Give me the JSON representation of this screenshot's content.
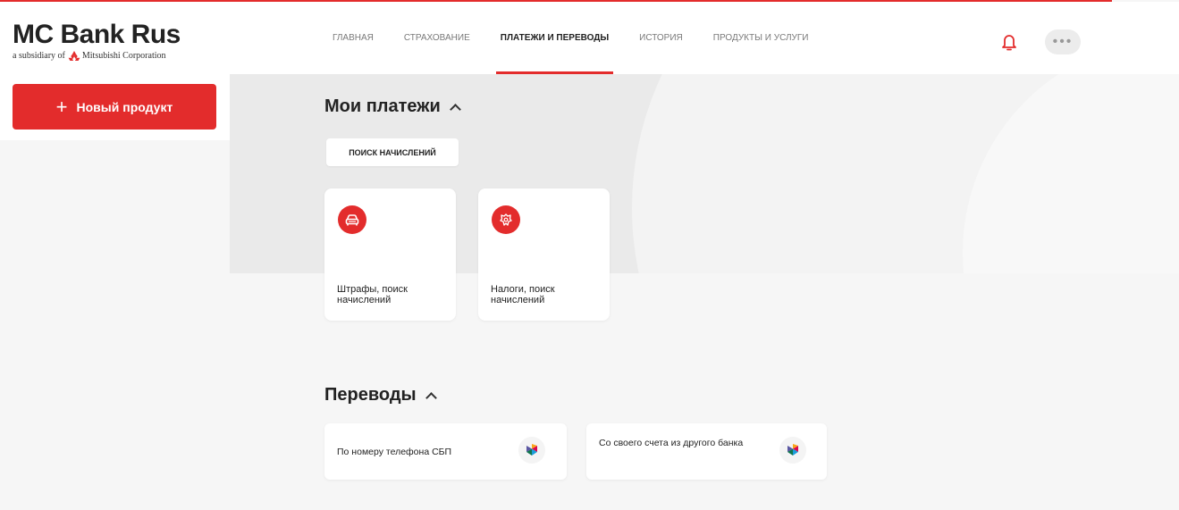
{
  "brand": {
    "name": "MC Bank Rus",
    "subtitle_prefix": "a subsidiary of",
    "subtitle_company": "Mitsubishi Corporation",
    "accent_color": "#e32c2c"
  },
  "nav": {
    "items": [
      {
        "label": "ГЛАВНАЯ",
        "active": false
      },
      {
        "label": "СТРАХОВАНИЕ",
        "active": false
      },
      {
        "label": "ПЛАТЕЖИ И ПЕРЕВОДЫ",
        "active": true
      },
      {
        "label": "ИСТОРИЯ",
        "active": false
      },
      {
        "label": "ПРОДУКТЫ И УСЛУГИ",
        "active": false
      }
    ],
    "bell_icon": "bell-icon",
    "more_icon": "more-dots-icon",
    "more_label": "•••"
  },
  "sidebar": {
    "new_product_label": "Новый продукт",
    "plus_icon": "plus-icon",
    "plus_glyph": "+"
  },
  "payments": {
    "title": "Мои платежи",
    "search_chip": "ПОИСК НАЧИСЛЕНИЙ",
    "cards": [
      {
        "label": "Штрафы, поиск начислений",
        "icon": "car-icon"
      },
      {
        "label": "Налоги, поиск начислений",
        "icon": "coat-of-arms-icon"
      }
    ]
  },
  "transfers": {
    "title": "Переводы",
    "cards": [
      {
        "label": "По номеру телефона СБП",
        "icon": "sbp-icon"
      },
      {
        "label": "Со своего счета из другого банка",
        "icon": "sbp-icon"
      }
    ]
  }
}
